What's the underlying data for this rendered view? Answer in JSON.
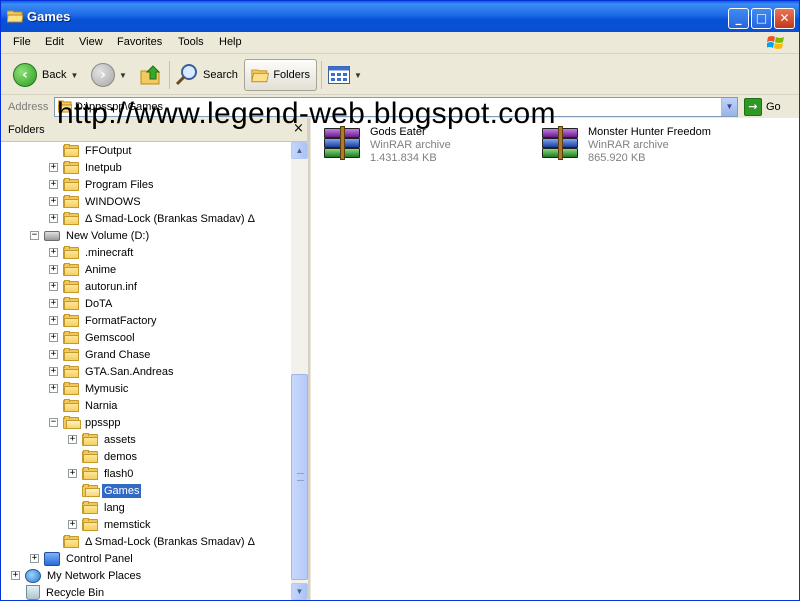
{
  "window": {
    "title": "Games"
  },
  "menu": [
    "File",
    "Edit",
    "View",
    "Favorites",
    "Tools",
    "Help"
  ],
  "toolbar": {
    "back": "Back",
    "search": "Search",
    "folders": "Folders"
  },
  "address": {
    "label": "Address",
    "value": "D:\\ppsspp\\Games",
    "go": "Go"
  },
  "folders_pane": {
    "title": "Folders",
    "items": [
      {
        "label": "FFOutput"
      },
      {
        "label": "Inetpub"
      },
      {
        "label": "Program Files"
      },
      {
        "label": "WINDOWS"
      },
      {
        "label": "Δ Smad-Lock (Brankas Smadav) Δ"
      },
      {
        "label": "New Volume (D:)"
      },
      {
        "label": ".minecraft"
      },
      {
        "label": "Anime"
      },
      {
        "label": "autorun.inf"
      },
      {
        "label": "DoTA"
      },
      {
        "label": "FormatFactory"
      },
      {
        "label": "Gemscool"
      },
      {
        "label": "Grand Chase"
      },
      {
        "label": "GTA.San.Andreas"
      },
      {
        "label": "Mymusic"
      },
      {
        "label": "Narnia"
      },
      {
        "label": "ppsspp"
      },
      {
        "label": "assets"
      },
      {
        "label": "demos"
      },
      {
        "label": "flash0"
      },
      {
        "label": "Games"
      },
      {
        "label": "lang"
      },
      {
        "label": "memstick"
      },
      {
        "label": "Δ Smad-Lock (Brankas Smadav) Δ"
      },
      {
        "label": "Control Panel"
      },
      {
        "label": "My Network Places"
      },
      {
        "label": "Recycle Bin"
      }
    ]
  },
  "files": [
    {
      "name": "Gods Eater",
      "type": "WinRAR archive",
      "size": "1.431.834 KB"
    },
    {
      "name": "Monster Hunter Freedom",
      "type": "WinRAR archive",
      "size": "865.920 KB"
    }
  ],
  "watermark": "http://www.legend-web.blogspot.com"
}
